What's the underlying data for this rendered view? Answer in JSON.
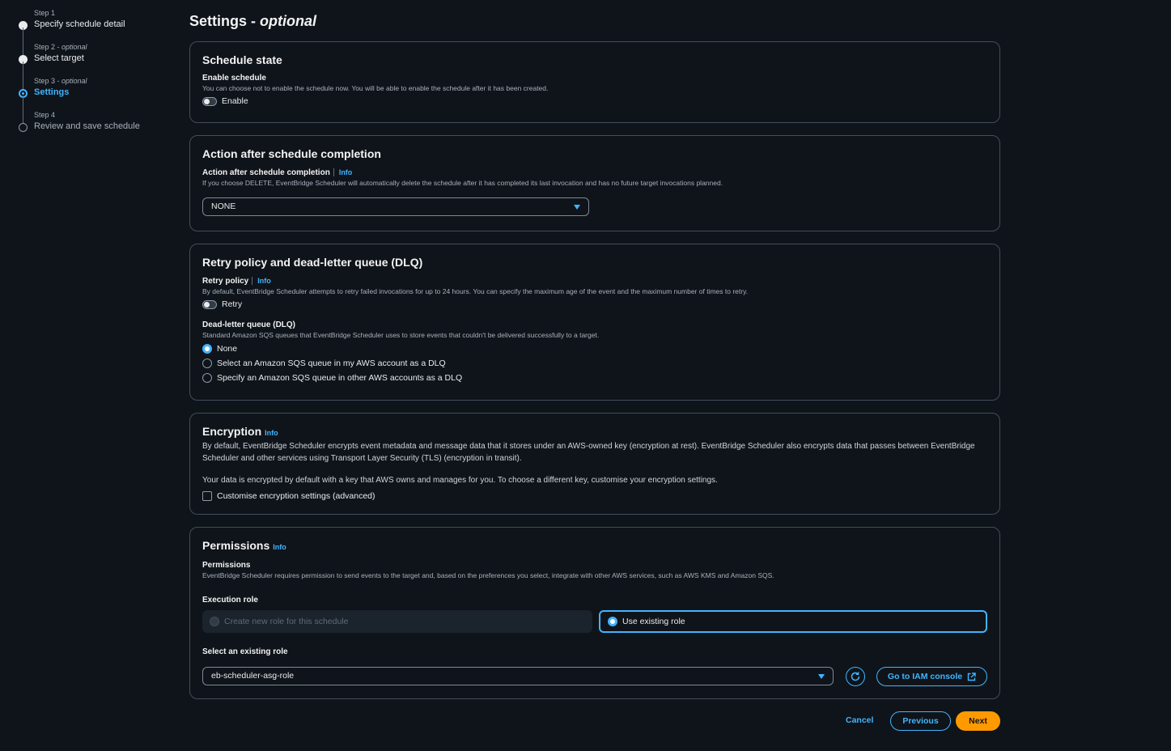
{
  "steps": [
    {
      "sub": "Step 1",
      "optional": "",
      "name": "Specify schedule detail"
    },
    {
      "sub": "Step 2 - ",
      "optional": "optional",
      "name": "Select target"
    },
    {
      "sub": "Step 3 - ",
      "optional": "optional",
      "name": "Settings"
    },
    {
      "sub": "Step 4",
      "optional": "",
      "name": "Review and save schedule"
    }
  ],
  "page": {
    "title": "Settings - ",
    "title_optional": "optional"
  },
  "schedule_state": {
    "heading": "Schedule state",
    "label": "Enable schedule",
    "desc": "You can choose not to enable the schedule now. You will be able to enable the schedule after it has been created.",
    "toggle_label": "Enable"
  },
  "action_after": {
    "heading": "Action after schedule completion",
    "label": "Action after schedule completion",
    "info": "Info",
    "desc": "If you choose DELETE, EventBridge Scheduler will automatically delete the schedule after it has completed its last invocation and has no future target invocations planned.",
    "value": "NONE"
  },
  "retry": {
    "heading": "Retry policy and dead-letter queue (DLQ)",
    "label": "Retry policy",
    "info": "Info",
    "desc": "By default, EventBridge Scheduler attempts to retry failed invocations for up to 24 hours. You can specify the maximum age of the event and the maximum number of times to retry.",
    "toggle_label": "Retry",
    "dlq_label": "Dead-letter queue (DLQ)",
    "dlq_desc": "Standard Amazon SQS queues that EventBridge Scheduler uses to store events that couldn't be delivered successfully to a target.",
    "options": [
      "None",
      "Select an Amazon SQS queue in my AWS account as a DLQ",
      "Specify an Amazon SQS queue in other AWS accounts as a DLQ"
    ]
  },
  "encryption": {
    "heading": "Encryption",
    "info": "Info",
    "desc": "By default, EventBridge Scheduler encrypts event metadata and message data that it stores under an AWS-owned key (encryption at rest). EventBridge Scheduler also encrypts data that passes between EventBridge Scheduler and other services using Transport Layer Security (TLS) (encryption in transit).",
    "note": "Your data is encrypted by default with a key that AWS owns and manages for you. To choose a different key, customise your encryption settings.",
    "checkbox_label": "Customise encryption settings (advanced)"
  },
  "permissions": {
    "heading": "Permissions",
    "info": "Info",
    "label": "Permissions",
    "desc": "EventBridge Scheduler requires permission to send events to the target and, based on the preferences you select, integrate with other AWS services, such as AWS KMS and Amazon SQS.",
    "exec_label": "Execution role",
    "create_role": "Create new role for this schedule",
    "use_existing": "Use existing role",
    "select_label": "Select an existing role",
    "role_value": "eb-scheduler-asg-role",
    "iam_button": "Go to IAM console"
  },
  "footer": {
    "cancel": "Cancel",
    "previous": "Previous",
    "next": "Next"
  }
}
